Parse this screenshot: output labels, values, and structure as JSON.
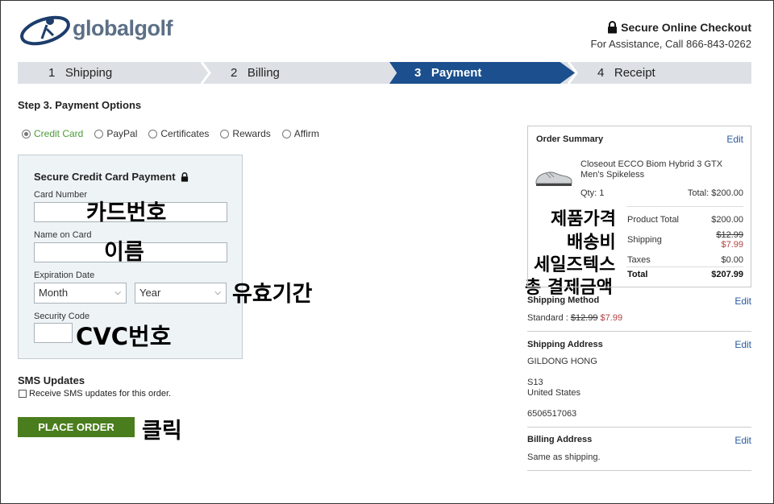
{
  "header": {
    "logo_text": "globalgolf",
    "secure_label": "Secure Online Checkout",
    "assistance": "For Assistance, Call 866-843-0262"
  },
  "steps": [
    {
      "num": "1",
      "label": "Shipping"
    },
    {
      "num": "2",
      "label": "Billing"
    },
    {
      "num": "3",
      "label": "Payment"
    },
    {
      "num": "4",
      "label": "Receipt"
    }
  ],
  "page_title": "Step 3. Payment Options",
  "payment_options": [
    "Credit Card",
    "PayPal",
    "Certificates",
    "Rewards",
    "Affirm"
  ],
  "card_form": {
    "title": "Secure Credit Card Payment",
    "card_number_label": "Card Number",
    "name_label": "Name on Card",
    "expiration_label": "Expiration Date",
    "month_value": "Month",
    "year_value": "Year",
    "security_label": "Security Code"
  },
  "sms": {
    "title": "SMS Updates",
    "checkbox_label": "Receive SMS updates for this order."
  },
  "place_order_label": "PLACE ORDER",
  "annotations": {
    "card_number": "카드번호",
    "name": "이름",
    "expiration": "유효기간",
    "cvc": "CVC번호",
    "click": "클릭",
    "product_price": "제품가격",
    "shipping_fee": "배송비",
    "sales_tax": "세일즈텍스",
    "total_amount": "총 결제금액"
  },
  "order_summary": {
    "title": "Order Summary",
    "edit": "Edit",
    "product_name": "Closeout ECCO Biom Hybrid 3 GTX Men's Spikeless",
    "qty": "Qty: 1",
    "line_total": "Total: $200.00",
    "product_total_label": "Product Total",
    "product_total_value": "$200.00",
    "shipping_label": "Shipping",
    "shipping_old": "$12.99",
    "shipping_new": "$7.99",
    "taxes_label": "Taxes",
    "taxes_value": "$0.00",
    "total_label": "Total",
    "total_value": "$207.99"
  },
  "shipping_method": {
    "title": "Shipping Method",
    "edit": "Edit",
    "prefix": "Standard : ",
    "old_price": "$12.99",
    "new_price": "$7.99"
  },
  "shipping_address": {
    "title": "Shipping Address",
    "edit": "Edit",
    "name": "GILDONG HONG",
    "line1": "S13",
    "country": "United States",
    "phone": "6506517063"
  },
  "billing_address": {
    "title": "Billing Address",
    "edit": "Edit",
    "text": "Same as shipping."
  },
  "colors": {
    "active_step": "#1b4f8e",
    "place_order": "#4a7d1d",
    "selected_option": "#4c9a3a",
    "link": "#2a5a9c"
  }
}
